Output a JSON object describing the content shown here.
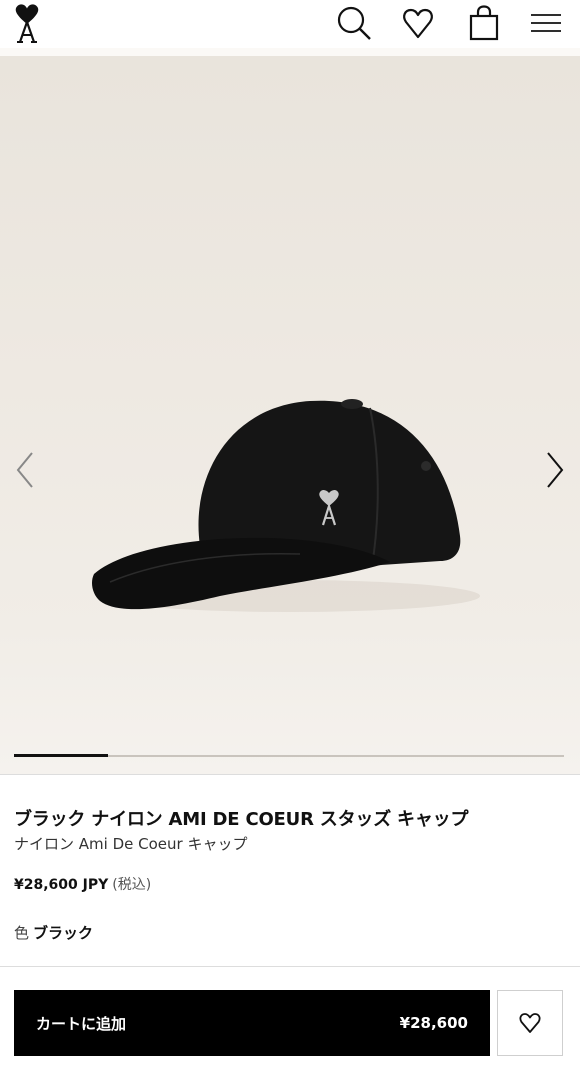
{
  "header": {
    "logo_icon": "ami-heart-a-logo-icon",
    "icons": [
      "search-icon",
      "heart-icon",
      "shopping-bag-icon",
      "hamburger-menu-icon"
    ]
  },
  "gallery": {
    "image_subject": "black nylon cap",
    "prev_icon": "chevron-left-icon",
    "next_icon": "chevron-right-icon",
    "progress_fraction": 0.17
  },
  "product": {
    "title": "ブラック ナイロン AMI DE COEUR スタッズ キャップ",
    "subtitle": "ナイロン Ami De Coeur キャップ",
    "price": "¥28,600 JPY",
    "tax_note": "(税込)",
    "color_label": "色",
    "color_value": "ブラック"
  },
  "cart": {
    "add_label": "カートに追加",
    "price": "¥28,600",
    "wishlist_icon": "heart-icon"
  }
}
